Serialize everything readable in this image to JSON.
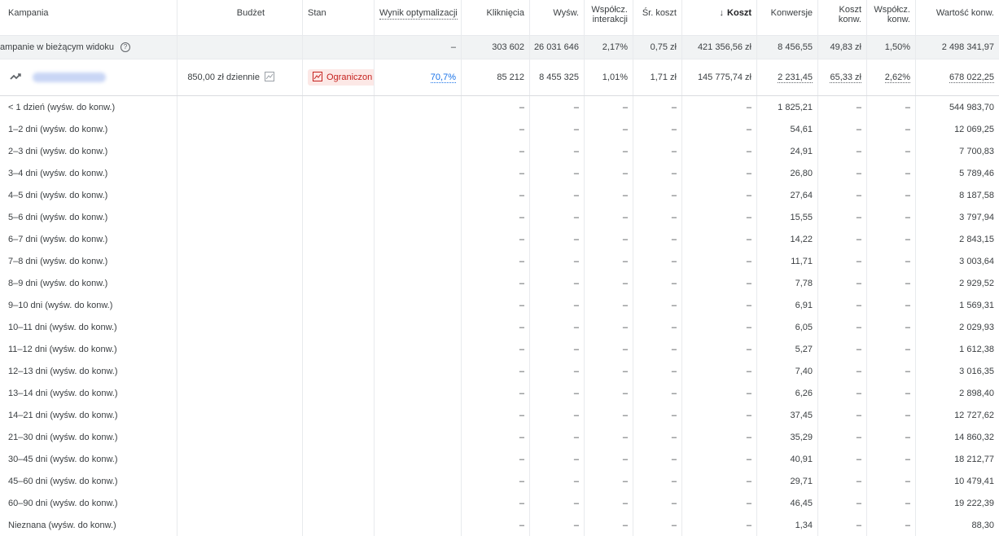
{
  "headers": {
    "campaign": "Kampania",
    "budget": "Budżet",
    "status": "Stan",
    "optimization": "Wynik optymalizacji",
    "clicks": "Kliknięcia",
    "impressions": "Wyśw.",
    "interaction_rate_1": "Współcz.",
    "interaction_rate_2": "interakcji",
    "avg_cost": "Śr. koszt",
    "cost": "Koszt",
    "conversions": "Konwersje",
    "cost_conv_1": "Koszt",
    "cost_conv_2": "konw.",
    "conv_rate_1": "Współcz.",
    "conv_rate_2": "konw.",
    "conv_value": "Wartość konw."
  },
  "total": {
    "label": "ampanie w bieżącym widoku",
    "help": "?",
    "budget": "",
    "status": "",
    "optimization": "–",
    "clicks": "303 602",
    "impressions": "26 031 646",
    "interaction_rate": "2,17%",
    "avg_cost": "0,75 zł",
    "cost": "421 356,56 zł",
    "conversions": "8 456,55",
    "cost_conv": "49,83 zł",
    "conv_rate": "1,50%",
    "conv_value": "2 498 341,97"
  },
  "campaign": {
    "budget": "850,00 zł dziennie",
    "status": "Ograniczon",
    "optimization": "70,7%",
    "clicks": "85 212",
    "impressions": "8 455 325",
    "interaction_rate": "1,01%",
    "avg_cost": "1,71 zł",
    "cost": "145 775,74 zł",
    "conversions": "2 231,45",
    "cost_conv": "65,33 zł",
    "conv_rate": "2,62%",
    "conv_value": "678 022,25"
  },
  "dash": "–",
  "rows": [
    {
      "label": "< 1 dzień (wyśw. do konw.)",
      "conversions": "1 825,21",
      "conv_value": "544 983,70"
    },
    {
      "label": "1–2 dni (wyśw. do konw.)",
      "conversions": "54,61",
      "conv_value": "12 069,25"
    },
    {
      "label": "2–3 dni (wyśw. do konw.)",
      "conversions": "24,91",
      "conv_value": "7 700,83"
    },
    {
      "label": "3–4 dni (wyśw. do konw.)",
      "conversions": "26,80",
      "conv_value": "5 789,46"
    },
    {
      "label": "4–5 dni (wyśw. do konw.)",
      "conversions": "27,64",
      "conv_value": "8 187,58"
    },
    {
      "label": "5–6 dni (wyśw. do konw.)",
      "conversions": "15,55",
      "conv_value": "3 797,94"
    },
    {
      "label": "6–7 dni (wyśw. do konw.)",
      "conversions": "14,22",
      "conv_value": "2 843,15"
    },
    {
      "label": "7–8 dni (wyśw. do konw.)",
      "conversions": "11,71",
      "conv_value": "3 003,64"
    },
    {
      "label": "8–9 dni (wyśw. do konw.)",
      "conversions": "7,78",
      "conv_value": "2 929,52"
    },
    {
      "label": "9–10 dni (wyśw. do konw.)",
      "conversions": "6,91",
      "conv_value": "1 569,31"
    },
    {
      "label": "10–11 dni (wyśw. do konw.)",
      "conversions": "6,05",
      "conv_value": "2 029,93"
    },
    {
      "label": "11–12 dni (wyśw. do konw.)",
      "conversions": "5,27",
      "conv_value": "1 612,38"
    },
    {
      "label": "12–13 dni (wyśw. do konw.)",
      "conversions": "7,40",
      "conv_value": "3 016,35"
    },
    {
      "label": "13–14 dni (wyśw. do konw.)",
      "conversions": "6,26",
      "conv_value": "2 898,40"
    },
    {
      "label": "14–21 dni (wyśw. do konw.)",
      "conversions": "37,45",
      "conv_value": "12 727,62"
    },
    {
      "label": "21–30 dni (wyśw. do konw.)",
      "conversions": "35,29",
      "conv_value": "14 860,32"
    },
    {
      "label": "30–45 dni (wyśw. do konw.)",
      "conversions": "40,91",
      "conv_value": "18 212,77"
    },
    {
      "label": "45–60 dni (wyśw. do konw.)",
      "conversions": "29,71",
      "conv_value": "10 479,41"
    },
    {
      "label": "60–90 dni (wyśw. do konw.)",
      "conversions": "46,45",
      "conv_value": "19 222,39"
    },
    {
      "label": "Nieznana (wyśw. do konw.)",
      "conversions": "1,34",
      "conv_value": "88,30"
    }
  ]
}
